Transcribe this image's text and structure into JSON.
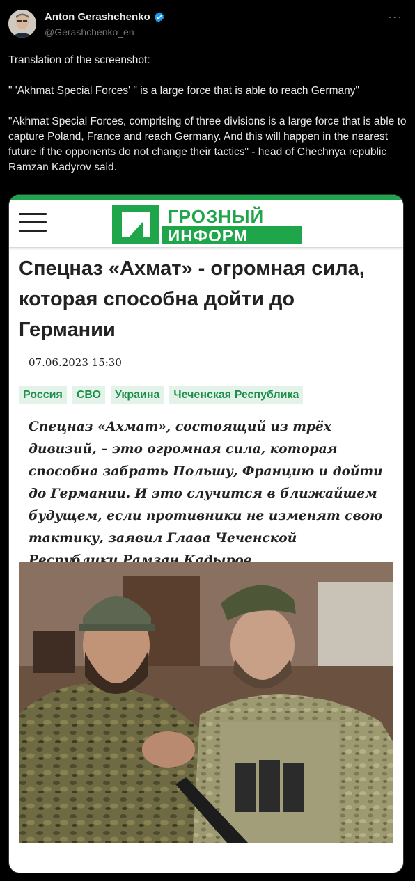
{
  "tweet": {
    "author_name": "Anton Gerashchenko",
    "author_handle": "@Gerashchenko_en",
    "more_label": "···",
    "text": "Translation of the screenshot:\n\n\" 'Akhmat Special Forces' \" is a large force that is able to reach Germany\"\n\n\"Akhmat Special Forces, comprising of three divisions is a large force that is able to capture Poland, France and reach Germany. And this will happen in the nearest future if the opponents do not change their tactics\" - head of Chechnya republic Ramzan Kadyrov said."
  },
  "article": {
    "logo_line1": "ГРОЗНЫЙ",
    "logo_line2": "ИНФОРМ",
    "headline": "Спецназ «Ахмат» - огромная сила, которая способна дойти до Германии",
    "date": "07.06.2023 15:30",
    "tags": [
      "Россия",
      "СВО",
      "Украина",
      "Чеченская Республика"
    ],
    "lead": "Спецназ «Ахмат», состоящий из трёх дивизий, – это огромная сила, которая способна забрать Польшу, Францию и дойти до Германии. И это случится в ближайшем будущем, если противники не изменят свою тактику, заявил Глава Чеченской Республики Рамзан Кадыров."
  },
  "colors": {
    "brand_green": "#1fa54a",
    "verified_blue": "#1d9bf0",
    "background": "#000000"
  },
  "icons": [
    "verified-icon",
    "more-icon",
    "hamburger-icon"
  ]
}
